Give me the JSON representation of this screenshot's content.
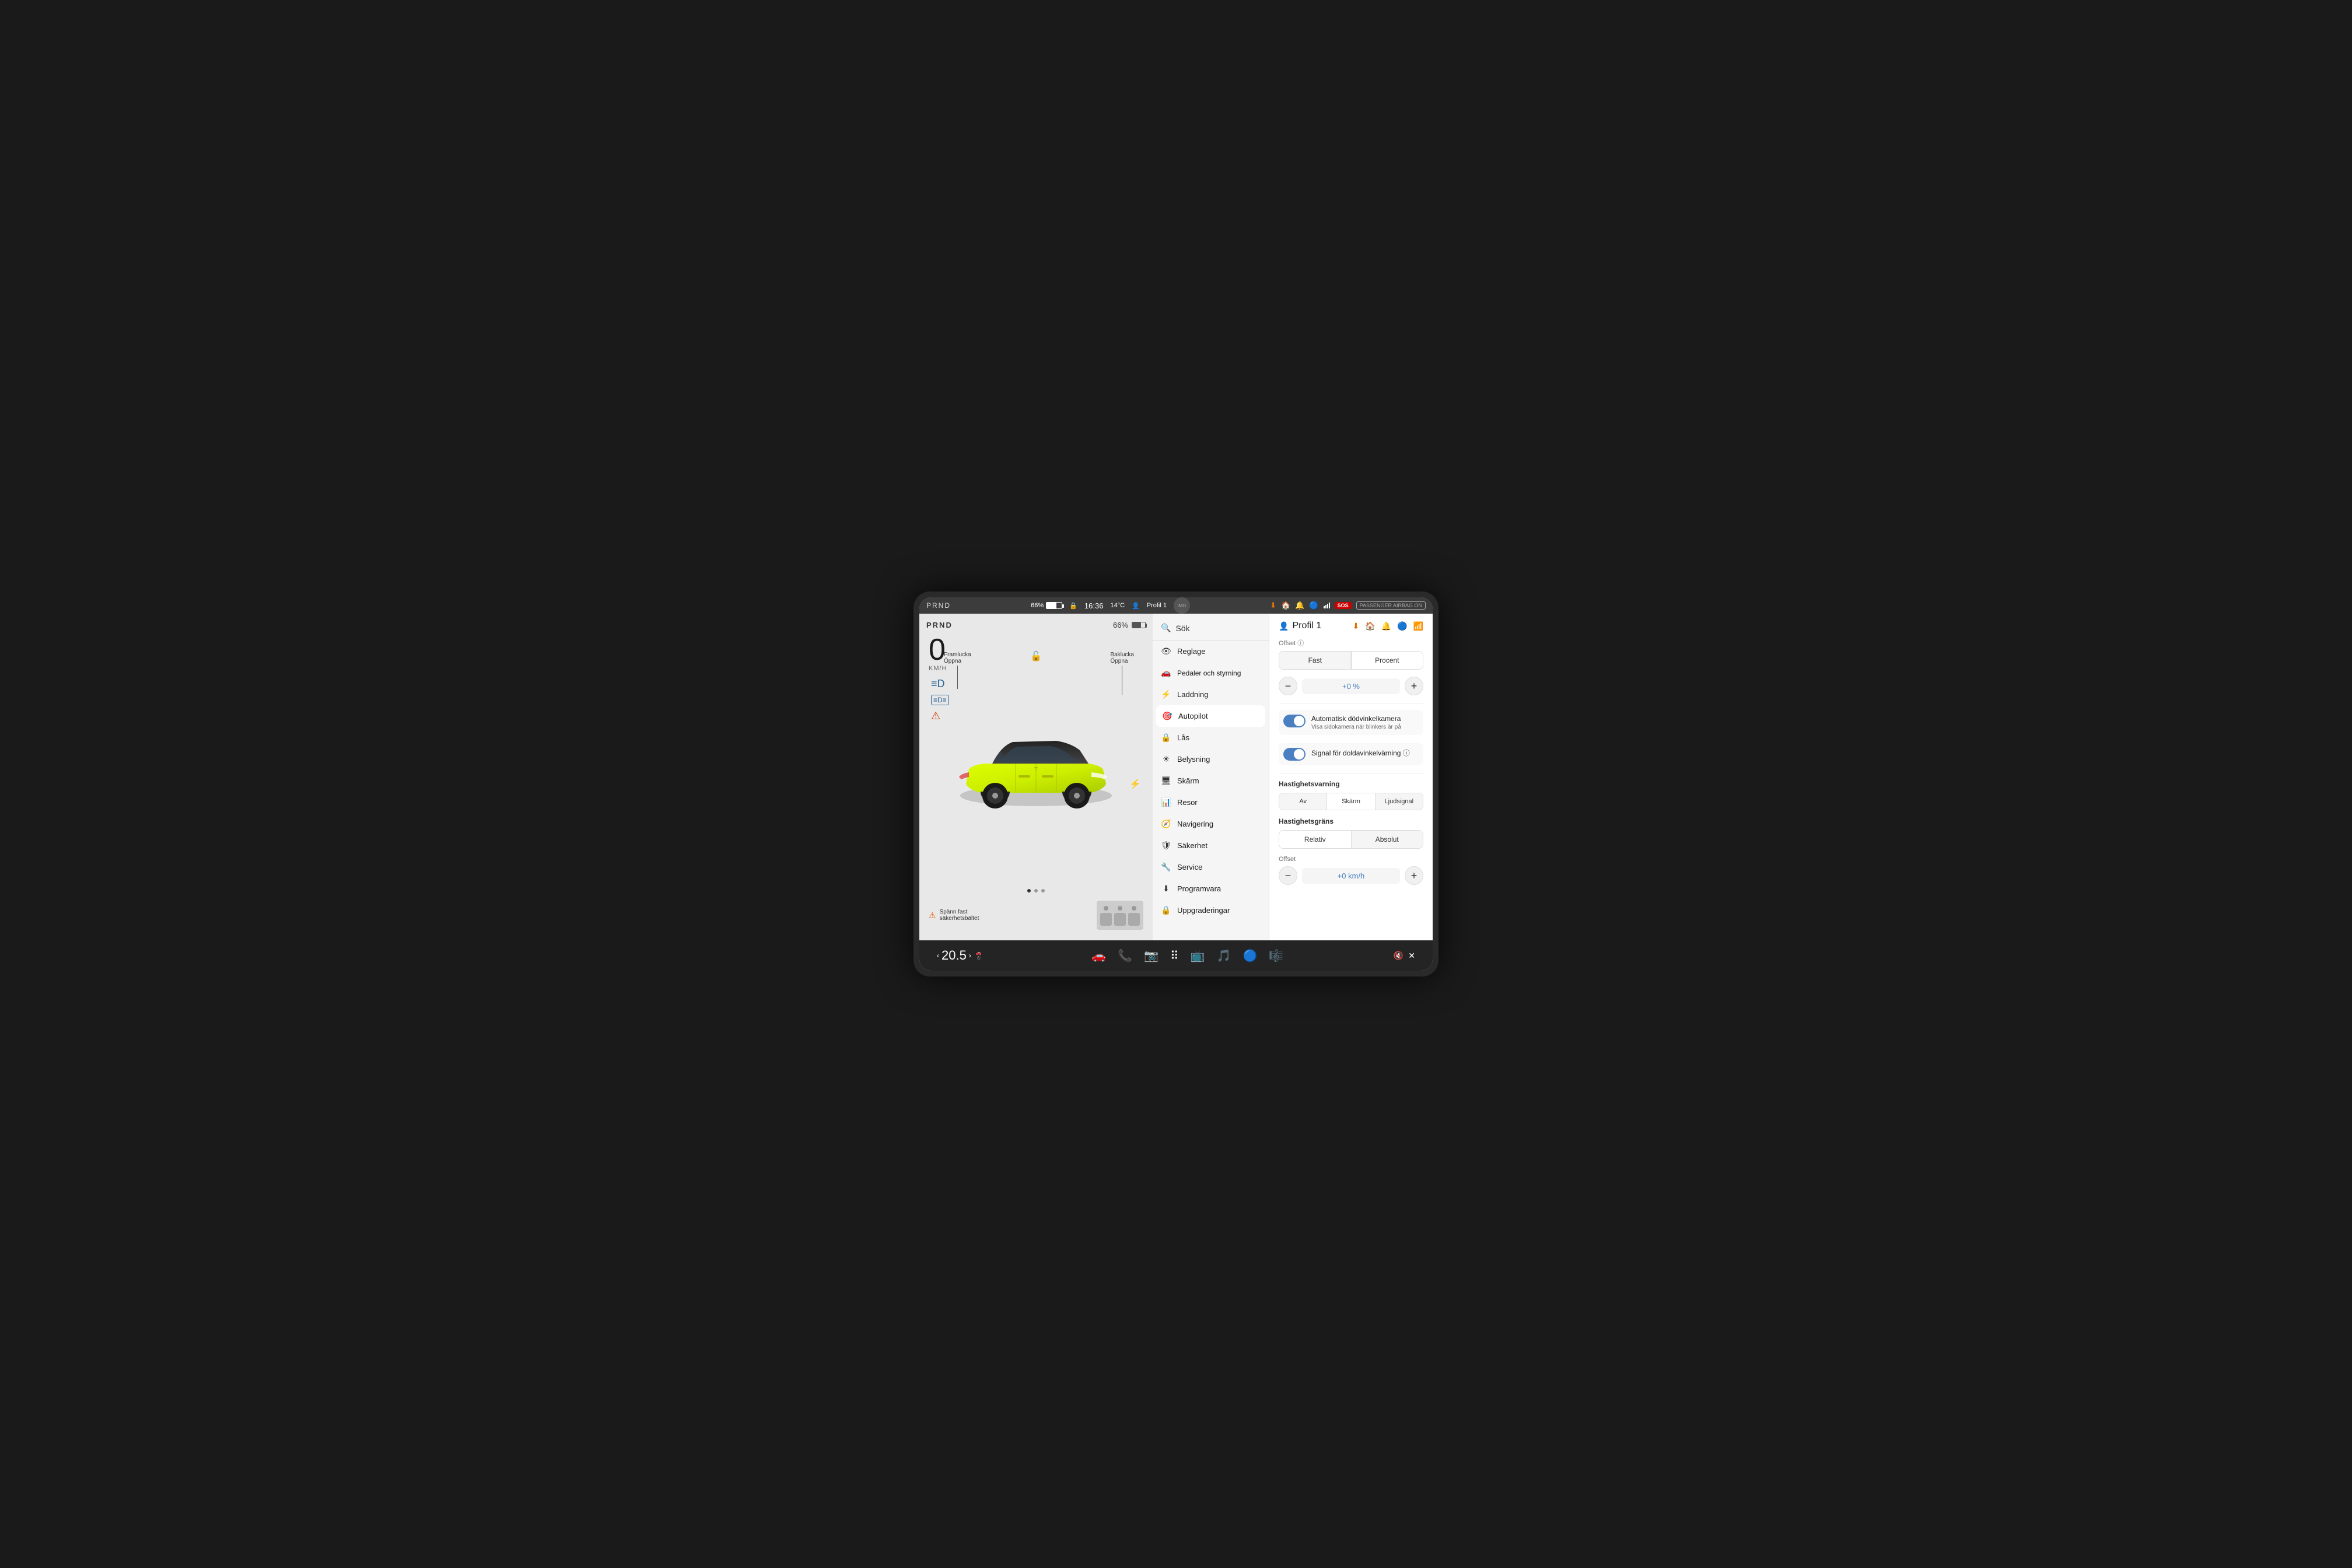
{
  "topbar": {
    "prnd": "PRND",
    "battery_pct": "66%",
    "time": "16:36",
    "temp": "14°C",
    "profile": "Profil 1",
    "sos": "SOS",
    "airbag": "PASSENGER AIRBAG ON"
  },
  "speed": {
    "value": "0",
    "unit": "KM/H"
  },
  "car_labels": {
    "front_door": "Framlucka\nÖppna",
    "rear_door": "Baklucka\nÖppna"
  },
  "pagination_dots": 3,
  "active_dot": 0,
  "seatbelt": "Spänn fast\nsäkerhetsbältet",
  "bottom_nav": {
    "speed": "20.5",
    "chevron_left": "‹",
    "chevron_right": "›"
  },
  "menu": {
    "search_placeholder": "Sök",
    "items": [
      {
        "id": "reglage",
        "label": "Reglage",
        "icon": "👁"
      },
      {
        "id": "pedaler",
        "label": "Pedaler och styrning",
        "icon": "🚗"
      },
      {
        "id": "laddning",
        "label": "Laddning",
        "icon": "⚡"
      },
      {
        "id": "autopilot",
        "label": "Autopilot",
        "icon": "🎯",
        "active": true
      },
      {
        "id": "las",
        "label": "Lås",
        "icon": "🔒"
      },
      {
        "id": "belysning",
        "label": "Belysning",
        "icon": "💡"
      },
      {
        "id": "skarm",
        "label": "Skärm",
        "icon": "🖥"
      },
      {
        "id": "resor",
        "label": "Resor",
        "icon": "📊"
      },
      {
        "id": "navigering",
        "label": "Navigering",
        "icon": "🧭"
      },
      {
        "id": "sakerhet",
        "label": "Säkerhet",
        "icon": "🛡"
      },
      {
        "id": "service",
        "label": "Service",
        "icon": "🔧"
      },
      {
        "id": "programvara",
        "label": "Programvara",
        "icon": "⬇"
      },
      {
        "id": "uppgraderingar",
        "label": "Uppgraderingar",
        "icon": "🔒"
      }
    ]
  },
  "settings": {
    "profile_name": "Profil 1",
    "offset_label": "Offset ⓘ",
    "speed_mode": {
      "options": [
        "Fast",
        "Procent"
      ],
      "active": "Procent"
    },
    "offset_value": "+0 %",
    "deadzone_camera": {
      "title": "Automatisk dödvinkelkamera",
      "subtitle": "Visa sidokamera när blinkers är på",
      "enabled": true
    },
    "blind_spot": {
      "title": "Signal för doldavinkelvärning ⓘ",
      "subtitle": "",
      "enabled": true
    },
    "speed_warning": {
      "label": "Hastighetsvarning",
      "options": [
        "Av",
        "Skärm",
        "Ljudsignal"
      ],
      "active": "Skärm"
    },
    "speed_limit": {
      "label": "Hastighetsgräns",
      "options": [
        "Relativ",
        "Absolut"
      ],
      "active": "Relativ"
    },
    "offset_section": {
      "label": "Offset",
      "value": "+0 km/h"
    }
  }
}
